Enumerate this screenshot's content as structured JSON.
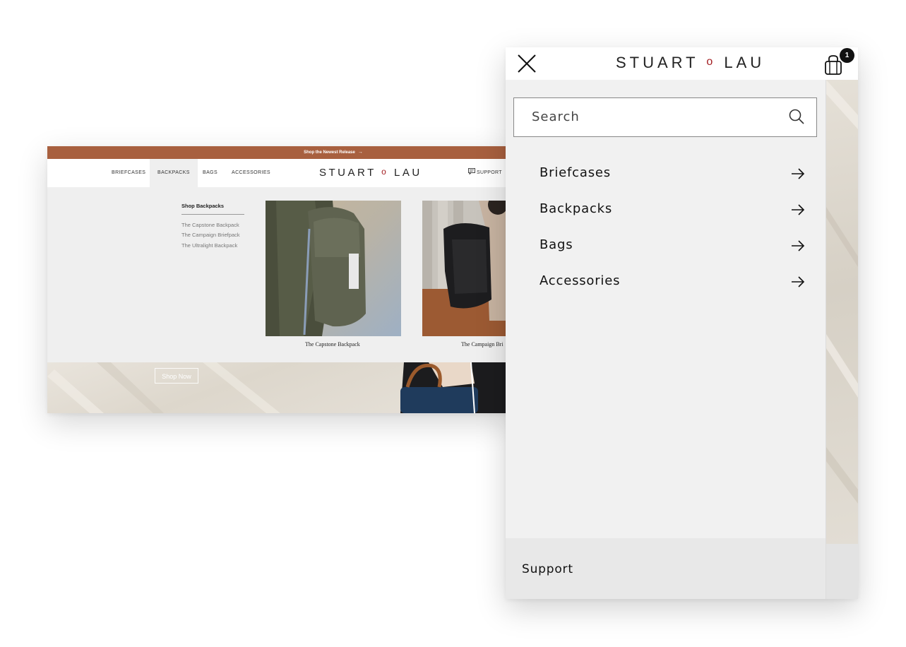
{
  "desktop": {
    "promo": {
      "text": "Shop the Newest Release",
      "arrow": "→"
    },
    "nav": {
      "items": [
        "BRIEFCASES",
        "BACKPACKS",
        "BAGS",
        "ACCESSORIES"
      ],
      "active": "BACKPACKS",
      "logo_left": "STUART",
      "logo_mark": "o",
      "logo_right": "LAU",
      "support": "SUPPORT"
    },
    "mega": {
      "title": "Shop Backpacks",
      "links": [
        "The Capstone Backpack",
        "The Campaign Briefpack",
        "The Ultralight Backpack"
      ],
      "products": [
        "The Capstone Backpack",
        "The Campaign Bri"
      ]
    },
    "hero": {
      "cta": "Shop Now"
    }
  },
  "mobile": {
    "logo_left": "STUART",
    "logo_mark": "o",
    "logo_right": "LAU",
    "cart_count": "1",
    "search_placeholder": "Search",
    "menu": [
      "Briefcases",
      "Backpacks",
      "Bags",
      "Accessories"
    ],
    "support": "Support"
  },
  "colors": {
    "promo_bar": "#a8603f",
    "logo_accent": "#a31e22",
    "panel_bg": "#f1f1f1"
  },
  "icons": [
    "close-icon",
    "shopping-bag-icon",
    "search-icon",
    "arrow-right-icon",
    "chat-icon"
  ]
}
